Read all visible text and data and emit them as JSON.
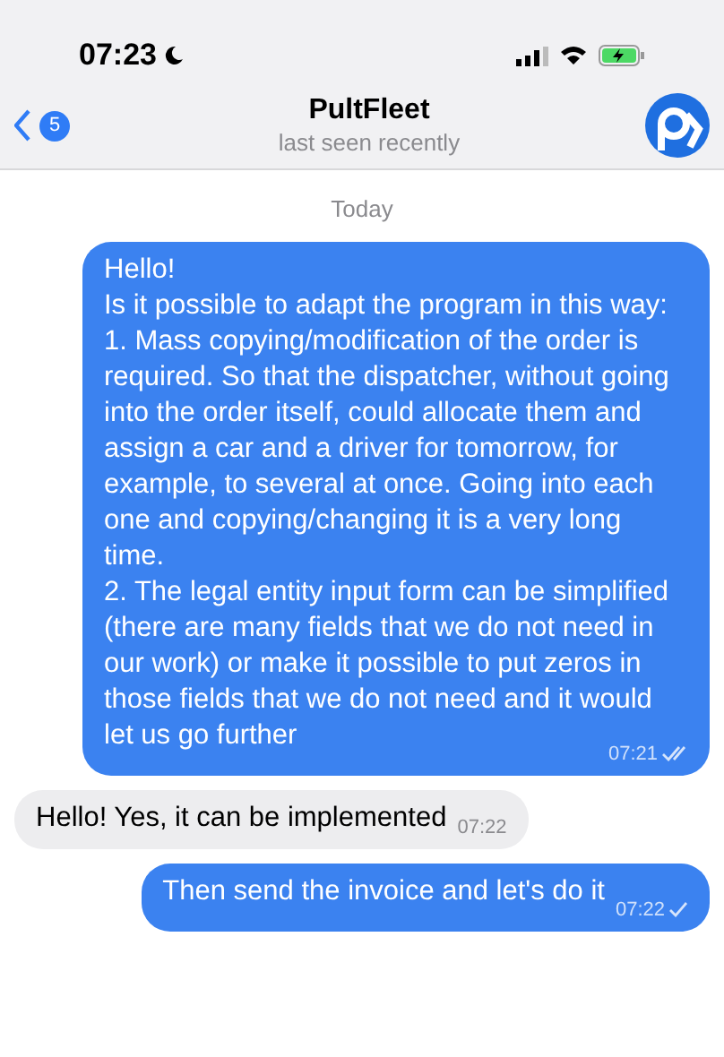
{
  "status_bar": {
    "time": "07:23"
  },
  "header": {
    "back_count": "5",
    "title": "PultFleet",
    "subtitle": "last seen recently"
  },
  "date_divider": "Today",
  "messages": [
    {
      "kind": "outgoing",
      "text": "Hello!\nIs it possible to adapt the program in this way:\n1. Mass copying/modification of the order is required. So that the dispatcher, without going into the order itself, could allocate them and assign a car and a driver for tomorrow, for example, to several at once. Going into each one and copying/changing it is a very long time.\n2. The legal entity input form can be simplified (there are many fields that we do not need in our work) or make it possible to put zeros in those fields that we do not need and it would let us go further",
      "time": "07:21",
      "read": true
    },
    {
      "kind": "incoming",
      "text": "Hello! Yes, it can be implemented",
      "time": "07:22"
    },
    {
      "kind": "outgoing",
      "text": "Then send the invoice and let's do it",
      "time": "07:22",
      "read": false
    }
  ]
}
